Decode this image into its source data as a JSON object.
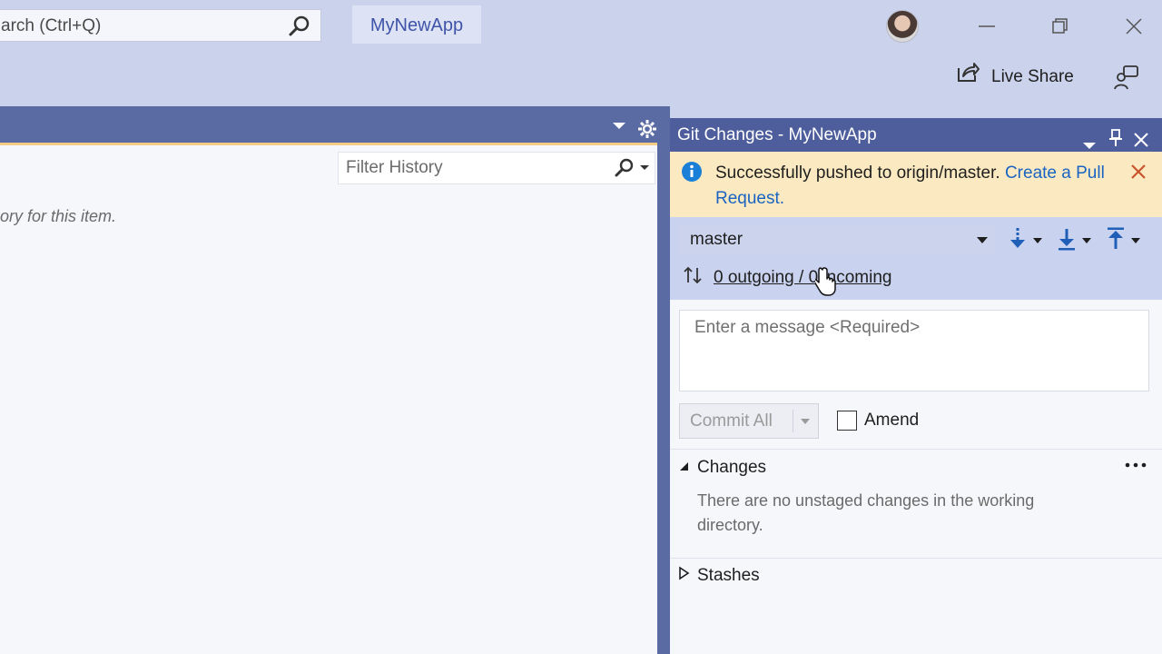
{
  "titlebar": {
    "search_text": "arch (Ctrl+Q)",
    "app_title": "MyNewApp",
    "live_share": "Live Share"
  },
  "history": {
    "filter_placeholder": "Filter History",
    "empty_text": "ory for this item."
  },
  "git": {
    "panel_title": "Git Changes - MyNewApp",
    "notice_text": "Successfully pushed to origin/master.",
    "notice_link": "Create a Pull Request.",
    "branch": "master",
    "sync_text": "0 outgoing / 0 incoming",
    "message_placeholder": "Enter a message <Required>",
    "commit_label": "Commit All",
    "amend_label": "Amend",
    "changes_label": "Changes",
    "changes_empty": "There are no unstaged changes in the working directory.",
    "stashes_label": "Stashes"
  }
}
